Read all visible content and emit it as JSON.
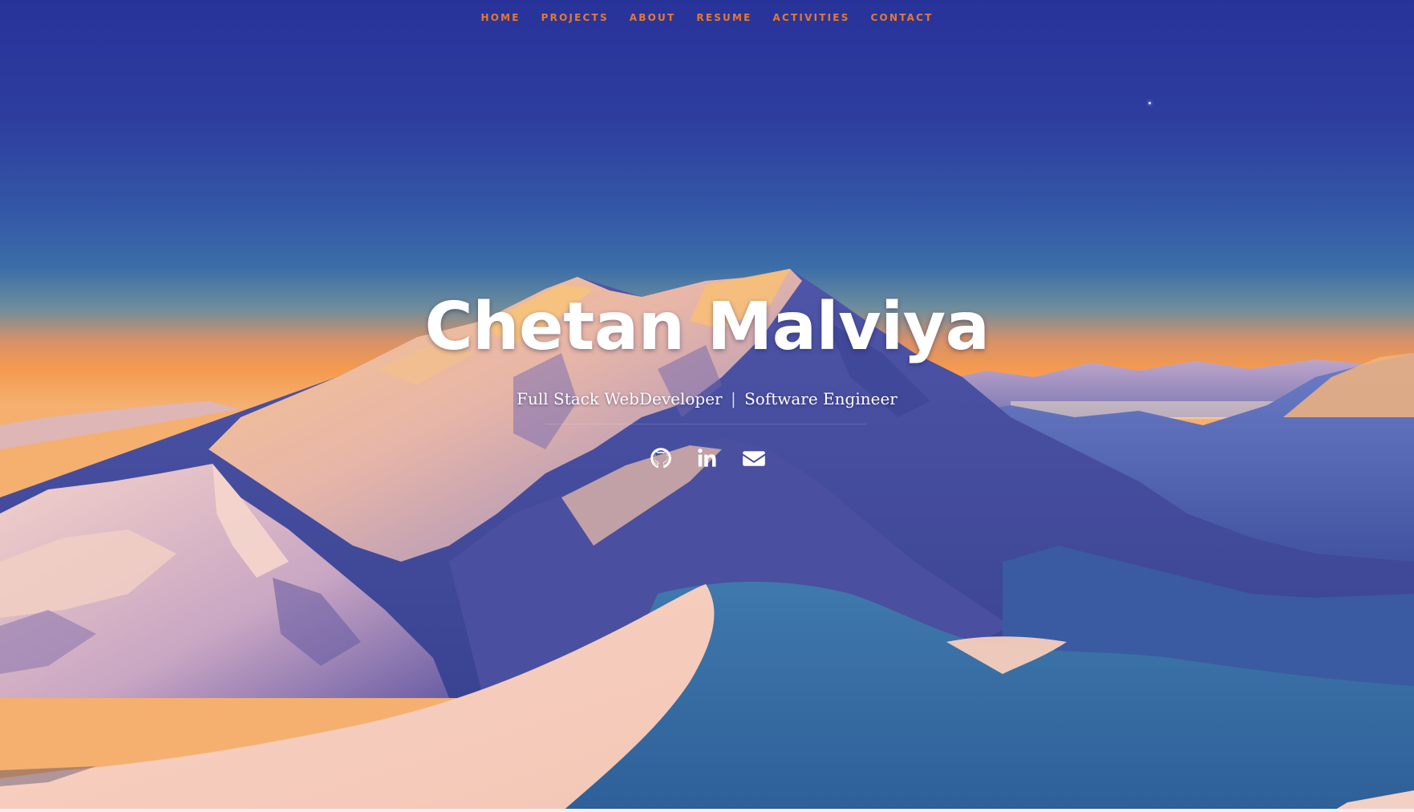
{
  "nav": {
    "items": [
      {
        "label": "HOME"
      },
      {
        "label": "PROJECTS"
      },
      {
        "label": "ABOUT"
      },
      {
        "label": "RESUME"
      },
      {
        "label": "ACTIVITIES"
      },
      {
        "label": "CONTACT"
      }
    ],
    "color": "#e5792f"
  },
  "hero": {
    "title": "Chetan Malviya",
    "subtitle_part1": "Full Stack WebDeveloper",
    "subtitle_separator": "|",
    "subtitle_part2": "Software Engineer"
  },
  "socials": [
    {
      "icon": "github-icon"
    },
    {
      "icon": "linkedin-icon"
    },
    {
      "icon": "envelope-icon"
    }
  ],
  "colors": {
    "sky_top": "#2a3597",
    "sky_mid": "#3a63a7",
    "horizon": "#f29a52",
    "mountain_lit": "#f5c27e",
    "mountain_shadow": "#5a57a8",
    "snow_foreground": "#f7cfbd",
    "snow_shadow": "#3f74ad"
  }
}
